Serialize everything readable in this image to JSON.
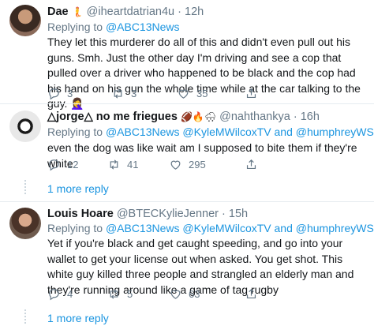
{
  "tweets": [
    {
      "name": "Dae",
      "name_emoji": "🧜",
      "handle": "@iheartdatrian4u",
      "dot": "·",
      "time": "12h",
      "replying_prefix": "Replying to",
      "replying_to": "@ABC13News",
      "body": "They let this murderer do all of this and didn't even pull out his guns. Smh. Just the other day I'm driving and see a cop that pulled over a driver who happened to be black and the cop had his hand on his gun the whole time while at the car talking to the guy. 🤦‍♀️",
      "replies": "3",
      "retweets": "3",
      "likes": "35"
    },
    {
      "name": "△jorge△ no me friegues",
      "name_emoji": "🏈🔥🌨",
      "handle": "@nahthankya",
      "dot": "·",
      "time": "16h",
      "replying_prefix": "Replying to",
      "replying_to": "@ABC13News @KyleMWilcoxTV and @humphreyWSET",
      "body": "even the dog was like wait am I supposed to bite them if they're white",
      "replies": "12",
      "retweets": "41",
      "likes": "295",
      "more_replies": "1 more reply"
    },
    {
      "name": "Louis Hoare",
      "handle": "@BTECKylieJenner",
      "dot": "·",
      "time": "15h",
      "replying_prefix": "Replying to",
      "replying_to": "@ABC13News @KyleMWilcoxTV and @humphreyWSET",
      "body": "Yet if you're black and get caught speeding, and go into your wallet to get your license out when asked. You get shot. This white guy killed three people and strangled an elderly man and they're running around like a game of tag rugby",
      "replies": "4",
      "retweets": "5",
      "likes": "63",
      "more_replies": "1 more reply"
    }
  ],
  "colors": {
    "link": "#1b95e0",
    "secondary_text": "#657786",
    "divider": "#e6ecf0"
  },
  "icons": [
    "reply-icon",
    "retweet-icon",
    "like-icon",
    "share-icon"
  ]
}
